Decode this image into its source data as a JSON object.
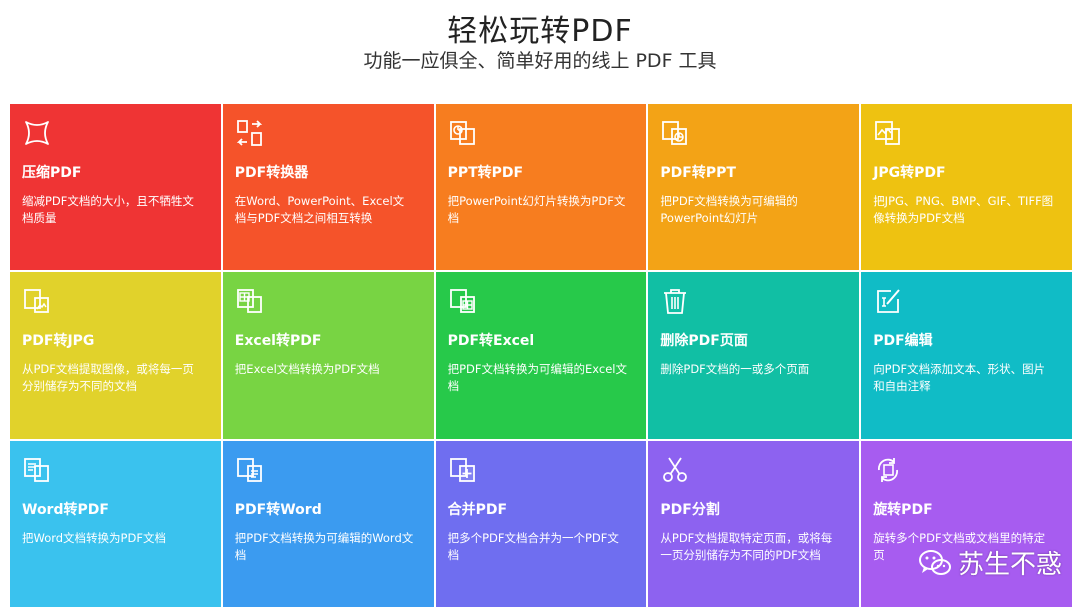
{
  "header": {
    "title": "轻松玩转PDF",
    "subtitle": "功能一应俱全、简单好用的线上 PDF 工具"
  },
  "tools": [
    {
      "name": "压缩PDF",
      "desc": "缩减PDF文档的大小，且不牺牲文档质量",
      "color": "#ef3434",
      "icon": "compress-icon"
    },
    {
      "name": "PDF转换器",
      "desc": "在Word、PowerPoint、Excel文档与PDF文档之间相互转换",
      "color": "#f5532a",
      "icon": "convert-icon"
    },
    {
      "name": "PPT转PDF",
      "desc": "把PowerPoint幻灯片转换为PDF文档",
      "color": "#f77d1f",
      "icon": "ppt-icon"
    },
    {
      "name": "PDF转PPT",
      "desc": "把PDF文档转换为可编辑的PowerPoint幻灯片",
      "color": "#f3a316",
      "icon": "pdf-to-ppt-icon"
    },
    {
      "name": "JPG转PDF",
      "desc": "把JPG、PNG、BMP、GIF、TIFF图像转换为PDF文档",
      "color": "#eec211",
      "icon": "image-icon"
    },
    {
      "name": "PDF转JPG",
      "desc": "从PDF文档提取图像，或将每一页分别储存为不同的文档",
      "color": "#e1d22b",
      "icon": "pdf-to-image-icon"
    },
    {
      "name": "Excel转PDF",
      "desc": "把Excel文档转换为PDF文档",
      "color": "#78d443",
      "icon": "excel-icon"
    },
    {
      "name": "PDF转Excel",
      "desc": "把PDF文档转换为可编辑的Excel文档",
      "color": "#27c94a",
      "icon": "pdf-to-excel-icon"
    },
    {
      "name": "删除PDF页面",
      "desc": "删除PDF文档的一或多个页面",
      "color": "#11bfa4",
      "icon": "trash-icon"
    },
    {
      "name": "PDF编辑",
      "desc": "向PDF文档添加文本、形状、图片和自由注释",
      "color": "#10bcc6",
      "icon": "edit-icon"
    },
    {
      "name": "Word转PDF",
      "desc": "把Word文档转换为PDF文档",
      "color": "#3ac2ee",
      "icon": "word-icon"
    },
    {
      "name": "PDF转Word",
      "desc": "把PDF文档转换为可编辑的Word文档",
      "color": "#3b9bf0",
      "icon": "pdf-to-word-icon"
    },
    {
      "name": "合并PDF",
      "desc": "把多个PDF文档合并为一个PDF文档",
      "color": "#6f6ef0",
      "icon": "merge-icon"
    },
    {
      "name": "PDF分割",
      "desc": "从PDF文档提取特定页面，或将每一页分别储存为不同的PDF文档",
      "color": "#8d62f0",
      "icon": "scissors-icon"
    },
    {
      "name": "旋转PDF",
      "desc": "旋转多个PDF文档或文档里的特定页",
      "color": "#a75cf0",
      "icon": "rotate-icon"
    }
  ],
  "watermark": {
    "text": "苏生不惑",
    "icon": "wechat-icon"
  }
}
